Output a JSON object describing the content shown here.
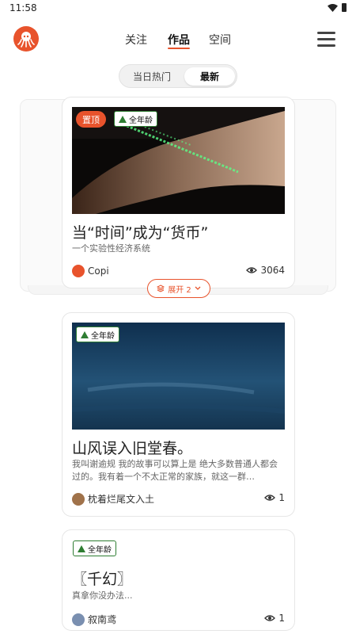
{
  "status_bar": {
    "time": "11:58"
  },
  "header": {
    "tabs": [
      {
        "label": "关注"
      },
      {
        "label": "作品"
      },
      {
        "label": "空间"
      }
    ]
  },
  "segment": {
    "options": [
      "当日热门",
      "最新"
    ],
    "selected": "最新"
  },
  "cards": [
    {
      "pin": "置顶",
      "age": "全年龄",
      "title": "当“时间”成为“货币”",
      "desc": "一个实验性经济系统",
      "author": "Copi",
      "views": "3064"
    },
    {
      "age": "全年龄",
      "title": "山风误入旧堂春。",
      "desc": "我叫谢逾规 我的故事可以算上是 绝大多数普通人都会过的。我有着一个不太正常的家族，就这一群…",
      "author": "枕着烂尾文入土",
      "views": "1"
    },
    {
      "age": "全年龄",
      "title": "〖千幻〗",
      "desc": "真拿你没办法...",
      "author": "叙南鸢",
      "views": "1"
    }
  ],
  "expand": {
    "label": "展开 2"
  },
  "colors": {
    "accent": "#e8532c",
    "age_green": "#2e7d32"
  }
}
